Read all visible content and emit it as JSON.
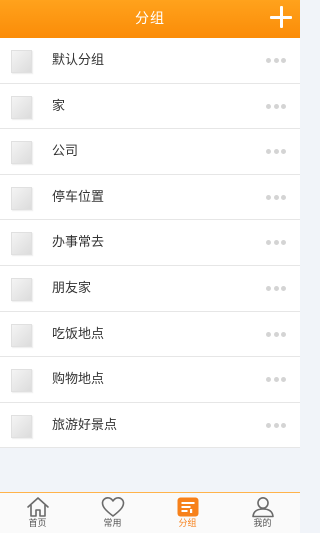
{
  "header": {
    "title": "分组",
    "add_icon": "plus-icon"
  },
  "groups": [
    {
      "label": "默认分组"
    },
    {
      "label": "家"
    },
    {
      "label": "公司"
    },
    {
      "label": "停车位置"
    },
    {
      "label": "办事常去"
    },
    {
      "label": "朋友家"
    },
    {
      "label": "吃饭地点"
    },
    {
      "label": "购物地点"
    },
    {
      "label": "旅游好景点"
    }
  ],
  "tabbar": {
    "tabs": [
      {
        "label": "首页",
        "icon": "home-icon"
      },
      {
        "label": "常用",
        "icon": "heart-icon"
      },
      {
        "label": "分组",
        "icon": "group-list-icon",
        "active": true
      },
      {
        "label": "我的",
        "icon": "user-icon"
      }
    ]
  },
  "colors": {
    "accent": "#fb8c08",
    "active_tab": "#f7811b",
    "background": "#f1f4f9"
  }
}
